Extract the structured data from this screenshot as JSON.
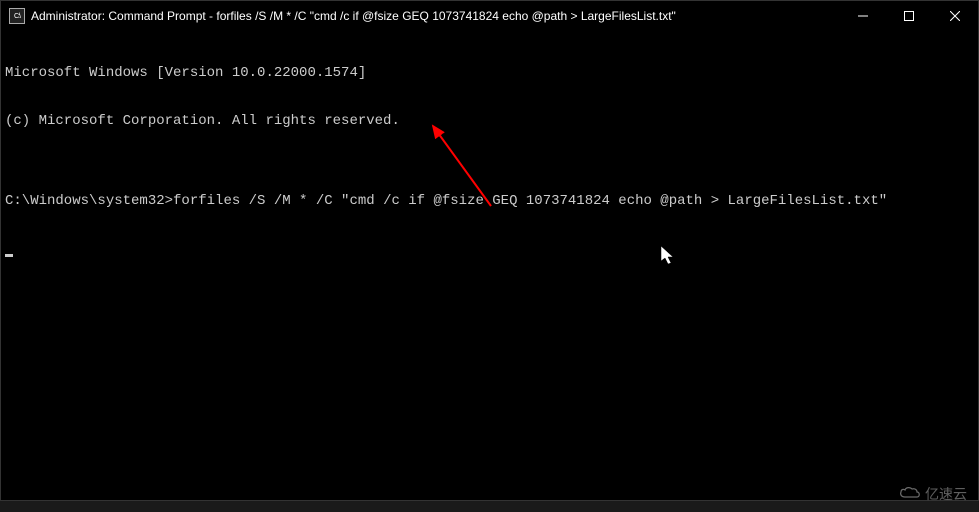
{
  "window": {
    "title": "Administrator: Command Prompt - forfiles  /S /M * /C \"cmd /c if @fsize GEQ 1073741824 echo @path > LargeFilesList.txt\"",
    "icon_label": "cmd"
  },
  "terminal": {
    "line1": "Microsoft Windows [Version 10.0.22000.1574]",
    "line2": "(c) Microsoft Corporation. All rights reserved.",
    "line3": "",
    "prompt": "C:\\Windows\\system32>",
    "command": "forfiles /S /M * /C \"cmd /c if @fsize GEQ 1073741824 echo @path > LargeFilesList.txt\""
  },
  "watermark": {
    "text": "亿速云"
  }
}
